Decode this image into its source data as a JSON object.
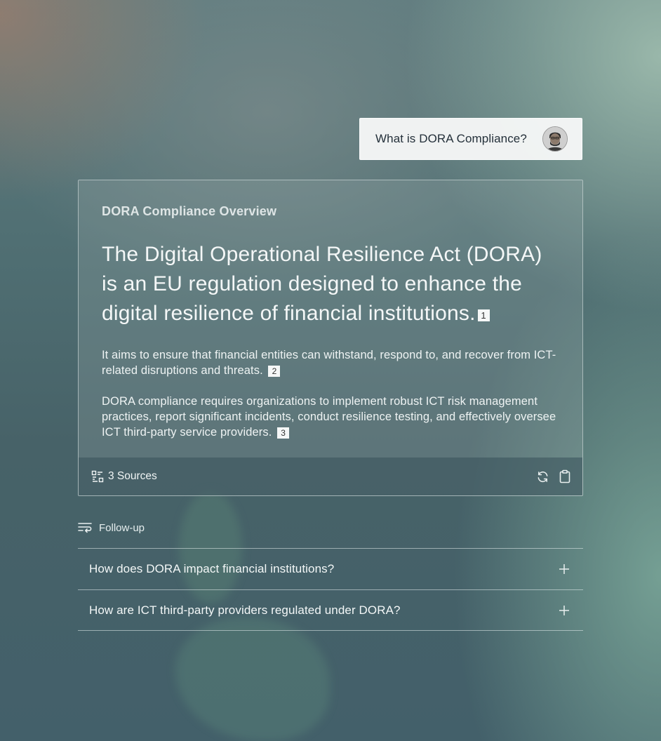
{
  "question": {
    "text": "What is DORA Compliance?",
    "avatar_icon": "user-avatar"
  },
  "answer": {
    "title": "DORA Compliance Overview",
    "headline": "The Digital Operational Resilience Act (DORA) is an EU regulation designed to enhance the digital resilience of financial institutions.",
    "headline_citation": "1",
    "paragraphs": [
      {
        "text": "It aims to ensure that financial entities can withstand, respond to, and recover from ICT-related disruptions and threats.",
        "citation": "2"
      },
      {
        "text": "DORA compliance requires organizations to implement robust ICT risk management practices, report significant incidents, conduct resilience testing, and effectively oversee ICT third-party service providers.",
        "citation": "3"
      }
    ],
    "footer": {
      "sources_label": "3 Sources",
      "sources_icon": "sources-icon",
      "regenerate_icon": "refresh-icon",
      "copy_icon": "clipboard-icon"
    }
  },
  "followup": {
    "label": "Follow-up",
    "icon": "follow-up-icon",
    "items": [
      {
        "text": "How does DORA impact financial institutions?",
        "icon": "plus-icon"
      },
      {
        "text": "How are ICT third-party providers regulated under DORA?",
        "icon": "plus-icon"
      }
    ]
  },
  "colors": {
    "card_text": "#f4f7f7",
    "bubble_bg": "#f6f7f7",
    "bubble_text": "#24303a"
  }
}
